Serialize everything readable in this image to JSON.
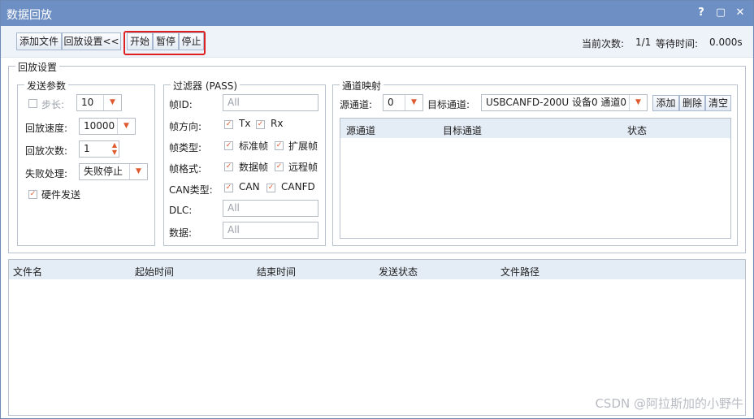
{
  "window": {
    "title": "数据回放",
    "help": "?",
    "restore": "▢",
    "close": "✕"
  },
  "toolbar": {
    "add_file": "添加文件",
    "replay_settings": "回放设置<<",
    "start": "开始",
    "pause": "暂停",
    "stop": "停止",
    "current_count_label": "当前次数:",
    "current_count": "1/1",
    "wait_time_label": "等待时间:",
    "wait_time": "0.000s"
  },
  "replay_settings": {
    "title": "回放设置",
    "send_params": {
      "title": "发送参数",
      "step_label": "步长:",
      "step_value": "10",
      "speed_label": "回放速度:",
      "speed_value": "10000",
      "count_label": "回放次数:",
      "count_value": "1",
      "fail_label": "失败处理:",
      "fail_value": "失败停止",
      "hw_send_label": "硬件发送"
    },
    "filter": {
      "title": "过滤器 (PASS)",
      "frame_id_label": "帧ID:",
      "frame_id_placeholder": "All",
      "direction_label": "帧方向:",
      "tx": "Tx",
      "rx": "Rx",
      "type_label": "帧类型:",
      "standard": "标准帧",
      "extended": "扩展帧",
      "format_label": "帧格式:",
      "data_frame": "数据帧",
      "remote_frame": "远程帧",
      "can_type_label": "CAN类型:",
      "can": "CAN",
      "canfd": "CANFD",
      "dlc_label": "DLC:",
      "dlc_placeholder": "All",
      "data_label": "数据:",
      "data_placeholder": "All"
    },
    "channel_map": {
      "title": "通道映射",
      "src_label": "源通道:",
      "src_value": "0",
      "dst_label": "目标通道:",
      "dst_value": "USBCANFD-200U 设备0 通道0",
      "add": "添加",
      "delete": "删除",
      "clear": "清空",
      "columns": [
        "源通道",
        "目标通道",
        "状态"
      ]
    }
  },
  "file_table": {
    "columns": [
      "文件名",
      "起始时间",
      "结束时间",
      "发送状态",
      "文件路径"
    ]
  },
  "watermark": "CSDN @阿拉斯加的小野牛"
}
